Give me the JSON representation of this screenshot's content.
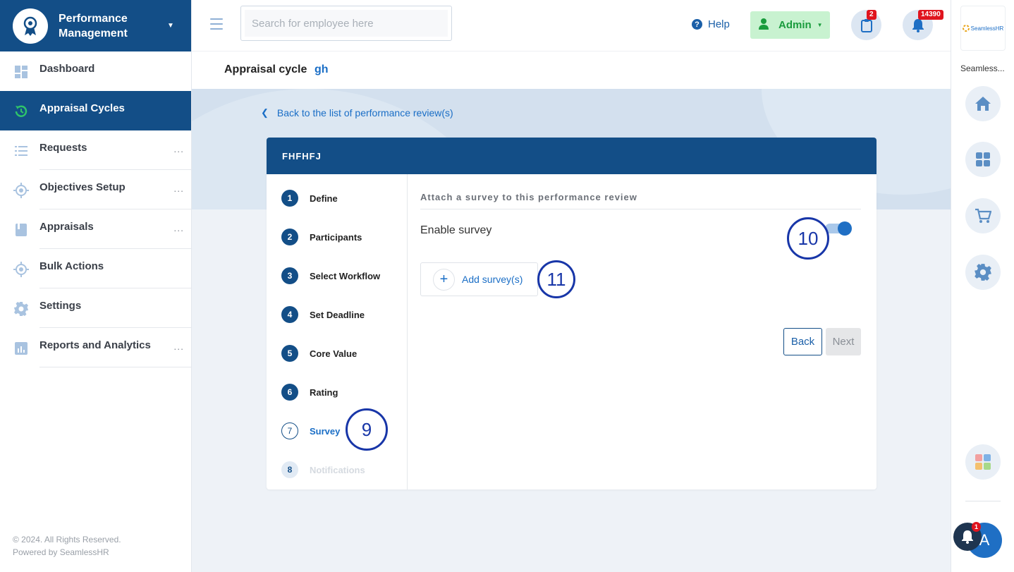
{
  "sidebar": {
    "app_title": "Performance Management",
    "items": [
      {
        "label": "Dashboard",
        "more": ""
      },
      {
        "label": "Appraisal Cycles",
        "more": ""
      },
      {
        "label": "Requests",
        "more": "..."
      },
      {
        "label": "Objectives Setup",
        "more": "..."
      },
      {
        "label": "Appraisals",
        "more": "..."
      },
      {
        "label": "Bulk Actions",
        "more": ""
      },
      {
        "label": "Settings",
        "more": ""
      },
      {
        "label": "Reports and Analytics",
        "more": "..."
      }
    ],
    "footer_line1": "© 2024. All Rights Reserved.",
    "footer_line2": "Powered by SeamlessHR"
  },
  "topbar": {
    "search_placeholder": "Search for employee here",
    "help_label": "Help",
    "admin_label": "Admin",
    "tasks_badge": "2",
    "notifications_badge": "14390"
  },
  "rail": {
    "logo_text": "SeamlessHR",
    "label": "Seamless...",
    "avatar_initial": "A",
    "bell_badge": "1"
  },
  "subheader": {
    "label": "Appraisal cycle",
    "value": "gh"
  },
  "back_link": "Back to the list of performance review(s)",
  "card": {
    "title": "FHFHFJ",
    "steps": [
      {
        "num": "1",
        "name": "Define"
      },
      {
        "num": "2",
        "name": "Participants"
      },
      {
        "num": "3",
        "name": "Select Workflow"
      },
      {
        "num": "4",
        "name": "Set Deadline"
      },
      {
        "num": "5",
        "name": "Core Value"
      },
      {
        "num": "6",
        "name": "Rating"
      },
      {
        "num": "7",
        "name": "Survey"
      },
      {
        "num": "8",
        "name": "Notifications"
      }
    ],
    "panel_title": "Attach a survey to this performance review",
    "enable_label": "Enable survey",
    "add_survey_label": "Add survey(s)",
    "back_label": "Back",
    "next_label": "Next"
  },
  "callouts": {
    "survey_step": "9",
    "toggle": "10",
    "add_survey": "11"
  },
  "colors": {
    "brand": "#134e87",
    "accent": "#1a6ec6",
    "admin_bg": "#c8f2d0",
    "badge": "#e0141e",
    "callout": "#1836a8"
  }
}
